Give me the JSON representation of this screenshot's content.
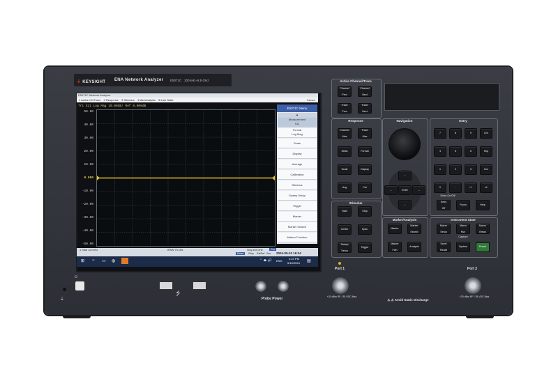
{
  "instrument": {
    "brand": "KEYSIGHT",
    "model_title": "ENA Network Analyzer",
    "model_number": "E5071C",
    "freq_range": "100 kHz–8.5 GHz"
  },
  "screen": {
    "app_title": "E5071C Network Analyzer",
    "menu": [
      "1 Active Ch/Trace",
      "2 Response",
      "3 Stimulus",
      "4 Mkr/Analysis",
      "5 Instr State"
    ],
    "menu_right": "Cursor",
    "trace_header": "Tr1  S11  Log Mag 10.00dB/ Ref 0.000dB",
    "y_labels": [
      "50.00",
      "40.00",
      "30.00",
      "20.00",
      "10.00",
      "0.000",
      "-10.00",
      "-20.00",
      "-30.00",
      "-40.00",
      "-50.00"
    ],
    "ref_value": "0.000",
    "softkey_title": "E5071C Menu",
    "softkeys": [
      "Measurement",
      "S11",
      "Format",
      "Log Mag",
      "Scale",
      "Display",
      "Average",
      "Calibration",
      "Stimulus",
      "Sweep Setup",
      "Trigger",
      "Marker",
      "Marker Search",
      "Marker Function"
    ],
    "status_left": "1  Start 100 kHz",
    "status_mid": "IFBW 70 kHz",
    "status_right": "Stop 8.5 GHz",
    "status_tag": "Cor",
    "status_row2": [
      "Meas",
      "Stop",
      "ExtRef",
      "Svc"
    ],
    "datetime": "2024-05-10 16:24",
    "taskbar_time": "4:24 PM",
    "taskbar_date": "5/10/2024",
    "taskbar_lang": "ENG"
  },
  "panels": {
    "active_channel": {
      "title": "Active Channel/Trace",
      "buttons": [
        [
          "Channel",
          "Prev"
        ],
        [
          "Channel",
          "Next"
        ],
        [
          "Trace",
          "Prev"
        ],
        [
          "Trace",
          "Next"
        ]
      ]
    },
    "response": {
      "title": "Response",
      "buttons": [
        [
          "Channel",
          "Max"
        ],
        [
          "Trace",
          "Max"
        ],
        [
          "Meas"
        ],
        [
          "Format"
        ],
        [
          "Scale"
        ],
        [
          "Display"
        ],
        [
          "Avg"
        ],
        [
          "Cal"
        ]
      ]
    },
    "stimulus": {
      "title": "Stimulus",
      "buttons": [
        [
          "Start"
        ],
        [
          "Stop"
        ],
        [
          "Center"
        ],
        [
          "Span"
        ],
        [
          "Sweep",
          "Setup"
        ],
        [
          "Trigger"
        ]
      ]
    },
    "navigation": {
      "title": "Navigation",
      "enter": "Enter",
      "arrows": [
        "↑",
        "←",
        "→",
        "↓"
      ]
    },
    "marker": {
      "title": "Marker/Analysis",
      "buttons": [
        [
          "Marker"
        ],
        [
          "Marker",
          "Search"
        ],
        [
          "Marker",
          "Fctn"
        ],
        [
          "Analysis"
        ]
      ]
    },
    "entry": {
      "title": "Entry",
      "keys": [
        "7",
        "8",
        "9",
        "G/n",
        "4",
        "5",
        "6",
        "M/μ",
        "1",
        "2",
        "3",
        "k/m",
        "0",
        ".",
        "+/-",
        "x1"
      ],
      "focus_label": "Entry On/Off",
      "bottom": [
        [
          "Entry",
          "Off"
        ],
        [
          "Focus"
        ],
        [
          "Help"
        ]
      ]
    },
    "instrument_state": {
      "title": "Instrument State",
      "buttons": [
        [
          "Macro",
          "Setup"
        ],
        [
          "Macro",
          "Run"
        ],
        [
          "Macro",
          "Break"
        ],
        [
          "Save/",
          "Recall"
        ],
        [
          "System"
        ],
        [
          "Preset"
        ]
      ],
      "capture_label": "Capture"
    }
  },
  "front": {
    "probe_power": "Probe Power",
    "port1": "Port 1",
    "port2": "Port 2",
    "port1_spec": "+20 dBm RF / 35 VDC Max",
    "port2_spec": "+20 dBm RF / 35 VDC Max",
    "esd_warning": "Avoid Static Discharge",
    "usb_symbol": "⭍"
  },
  "colors": {
    "trace": "#e6c12b",
    "softkey_title": "#3d5fa8",
    "preset_button": "#2f7a3a"
  }
}
